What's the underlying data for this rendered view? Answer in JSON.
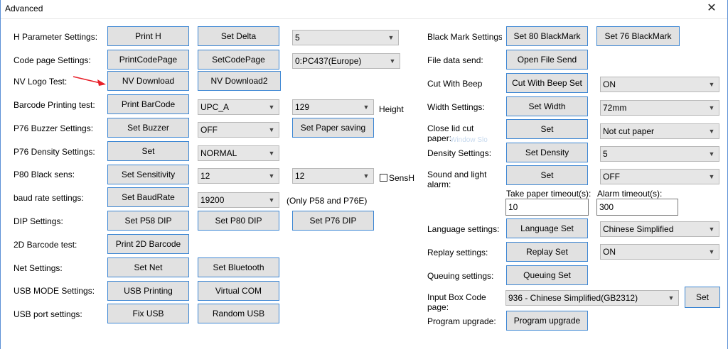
{
  "window": {
    "title": "Advanced",
    "close_glyph": "✕"
  },
  "left": {
    "h_param": {
      "label": "H Parameter Settings:",
      "btn1": "Print H",
      "btn2": "Set Delta",
      "dd": "5"
    },
    "code_page": {
      "label": "Code page Settings:",
      "btn1": "PrintCodePage",
      "btn2": "SetCodePage",
      "dd": "0:PC437(Europe)"
    },
    "nv_logo": {
      "label": "NV Logo Test:",
      "btn1": "NV Download",
      "btn2": "NV Download2"
    },
    "barcode": {
      "label": "Barcode Printing test:",
      "btn1": "Print BarCode",
      "dd1": "UPC_A",
      "dd2": "129",
      "height_label": "Height"
    },
    "buzzer": {
      "label": "P76 Buzzer Settings:",
      "btn1": "Set Buzzer",
      "dd": "OFF",
      "btn2": "Set Paper saving"
    },
    "density": {
      "label": "P76 Density Settings:",
      "btn1": "Set",
      "dd": "NORMAL"
    },
    "black_sens": {
      "label": "P80 Black sens:",
      "btn1": "Set Sensitivity",
      "dd1": "12",
      "dd2": "12",
      "check_label": "SensH"
    },
    "baud": {
      "label": "baud rate settings:",
      "btn1": "Set BaudRate",
      "dd": "19200",
      "note": "(Only P58 and P76E)"
    },
    "dip": {
      "label": "DIP Settings:",
      "btn1": "Set P58 DIP",
      "btn2": "Set P80 DIP",
      "btn3": "Set P76 DIP"
    },
    "barcode2d": {
      "label": "2D Barcode test:",
      "btn1": "Print 2D Barcode"
    },
    "net": {
      "label": "Net Settings:",
      "btn1": "Set Net",
      "btn2": "Set Bluetooth"
    },
    "usb_mode": {
      "label": "USB MODE Settings:",
      "btn1": "USB Printing",
      "btn2": "Virtual COM"
    },
    "usb_port": {
      "label": "USB port settings:",
      "btn1": "Fix USB",
      "btn2": "Random USB"
    }
  },
  "right": {
    "black_mark": {
      "label": "Black Mark Settings:",
      "btn1": "Set 80 BlackMark",
      "btn2": "Set 76 BlackMark"
    },
    "file_data": {
      "label": "File data send:",
      "btn1": "Open File Send"
    },
    "cut_beep": {
      "label": "Cut With Beep",
      "btn1": "Cut With Beep Set",
      "dd": "ON"
    },
    "width": {
      "label": "Width Settings:",
      "btn1": "Set Width",
      "dd": "72mm"
    },
    "close_lid": {
      "label": "Close lid cut paper:",
      "btn1": "Set",
      "dd": "Not cut paper"
    },
    "density": {
      "label": "Density Settings:",
      "btn1": "Set Density",
      "dd": "5"
    },
    "sound": {
      "label": "Sound and light alarm:",
      "btn1": "Set",
      "dd": "OFF"
    },
    "timeouts": {
      "take_label": "Take paper timeout(s):",
      "take_value": "10",
      "alarm_label": "Alarm timeout(s):",
      "alarm_value": "300"
    },
    "language": {
      "label": "Language settings:",
      "btn1": "Language Set",
      "dd": "Chinese Simplified"
    },
    "replay": {
      "label": "Replay settings:",
      "btn1": "Replay Set",
      "dd": "ON"
    },
    "queuing": {
      "label": "Queuing settings:",
      "btn1": "Queuing Set"
    },
    "input_box": {
      "label": "Input Box Code page:",
      "dd": "936 - Chinese Simplified(GB2312)",
      "btn1": "Set"
    },
    "upgrade": {
      "label": "Program upgrade:",
      "btn1": "Program upgrade"
    }
  },
  "icons": {
    "dropdown": "chevron-down-icon",
    "close": "close-icon",
    "annotation": "red-arrow-icon"
  },
  "colors": {
    "button_border": "#3c86d3",
    "button_bg": "#e1e1e1",
    "window_border": "#5a8fd6",
    "arrow": "#e8202a"
  }
}
